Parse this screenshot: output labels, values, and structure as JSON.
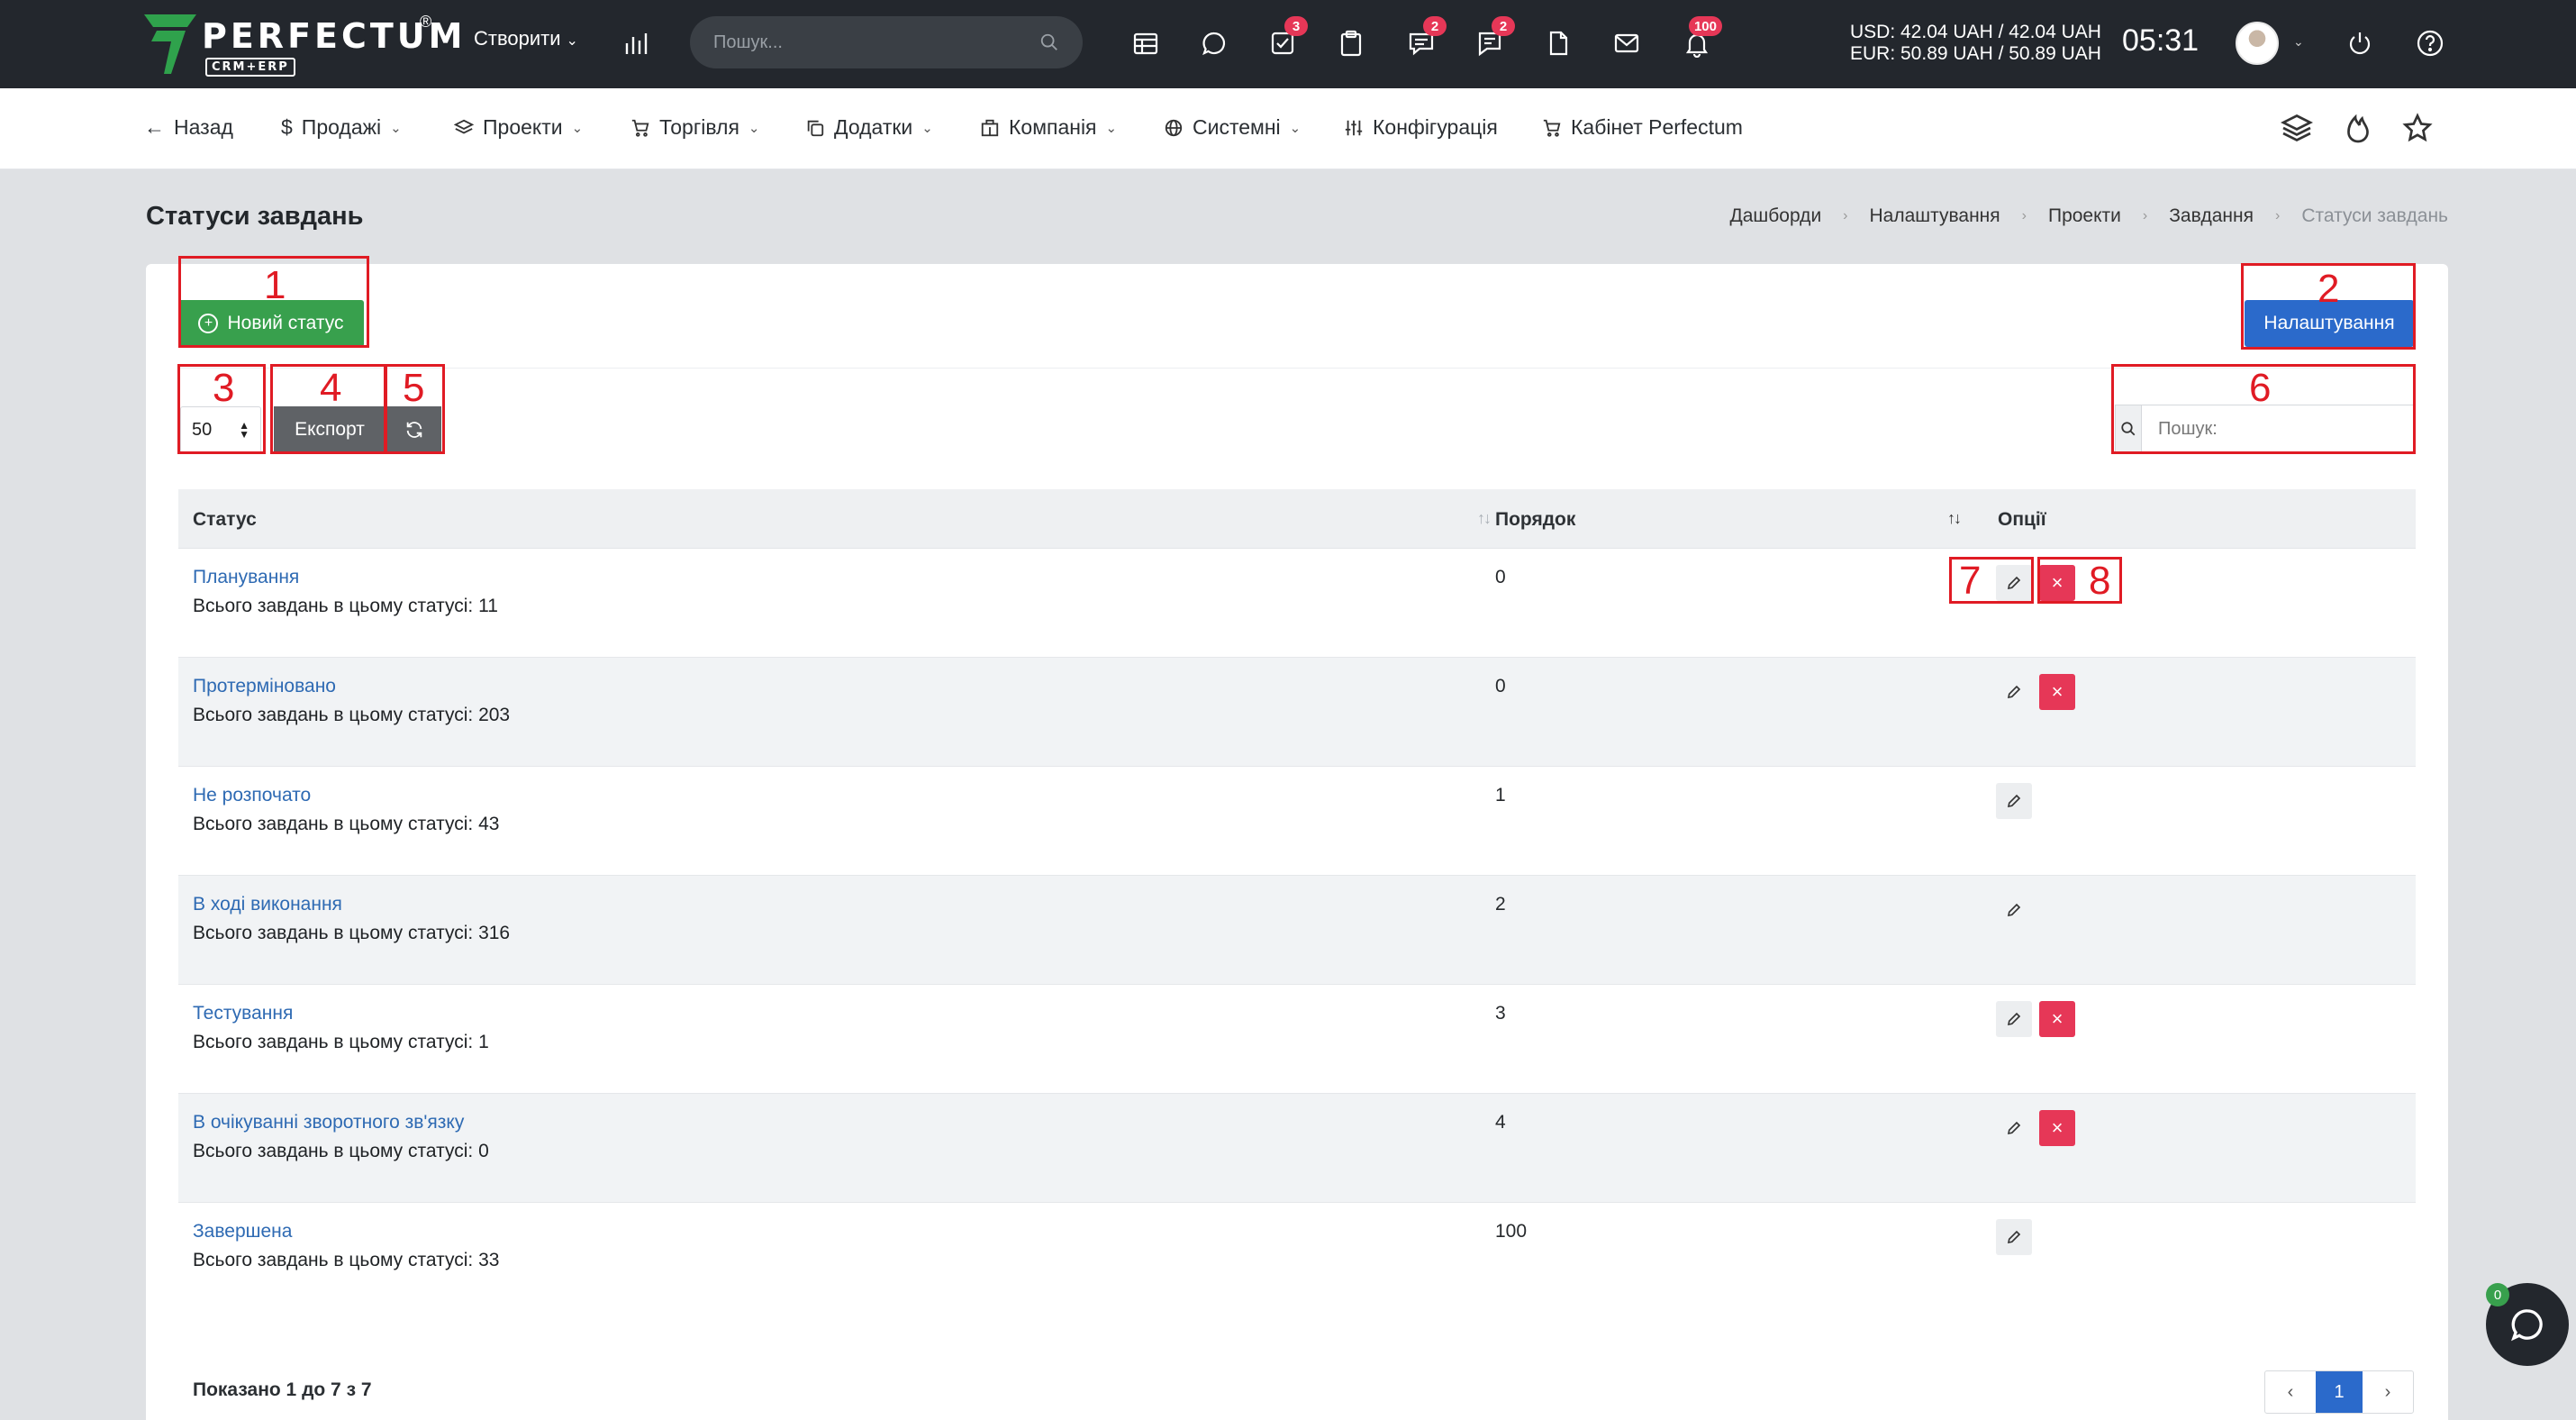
{
  "topbar": {
    "brand": "PERFECTUM",
    "brand_sub": "CRM+ERP",
    "reg_mark": "®",
    "create_label": "Створити",
    "search_placeholder": "Пошук...",
    "badges": {
      "tasks": "3",
      "chat": "2",
      "messages": "2",
      "notifications": "100"
    },
    "usd_rate": "USD: 42.04 UAH / 42.04 UAH",
    "eur_rate": "EUR: 50.89 UAH / 50.89 UAH",
    "time": "05:31"
  },
  "nav": {
    "back": "Назад",
    "sales": "Продажі",
    "projects": "Проекти",
    "trade": "Торгівля",
    "addons": "Додатки",
    "company": "Компанія",
    "system": "Системні",
    "config": "Конфігурація",
    "cabinet": "Кабінет Perfectum"
  },
  "page": {
    "title": "Статуси завдань",
    "breadcrumb": [
      "Дашборди",
      "Налаштування",
      "Проекти",
      "Завдання",
      "Статуси завдань"
    ]
  },
  "toolbar": {
    "new_status": "Новий статус",
    "settings": "Налаштування",
    "page_length": "50",
    "export": "Експорт",
    "search_placeholder": "Пошук:"
  },
  "annotations": [
    "1",
    "2",
    "3",
    "4",
    "5",
    "6",
    "7",
    "8"
  ],
  "table": {
    "columns": [
      "Статус",
      "Порядок",
      "Опції"
    ],
    "count_prefix": "Всього завдань в цьому статусі:",
    "rows": [
      {
        "name": "Планування",
        "count_text": "Всього завдань в цьому статусі: 11",
        "order": "0",
        "can_delete": true
      },
      {
        "name": "Протерміновано",
        "count_text": "Всього завдань в цьому статусі: 203",
        "order": "0",
        "can_delete": true
      },
      {
        "name": "Не розпочато",
        "count_text": "Всього завдань в цьому статусі: 43",
        "order": "1",
        "can_delete": false
      },
      {
        "name": "В ході виконання",
        "count_text": "Всього завдань в цьому статусі: 316",
        "order": "2",
        "can_delete": false
      },
      {
        "name": "Тестування",
        "count_text": "Всього завдань в цьому статусі: 1",
        "order": "3",
        "can_delete": true
      },
      {
        "name": "В очікуванні зворотного зв'язку",
        "count_text": "Всього завдань в цьому статусі: 0",
        "order": "4",
        "can_delete": true
      },
      {
        "name": "Завершена",
        "count_text": "Всього завдань в цьому статусі: 33",
        "order": "100",
        "can_delete": false
      }
    ]
  },
  "footer": {
    "info": "Показано 1 до 7 з 7",
    "current_page": "1"
  },
  "chat_widget": {
    "badge": "0"
  },
  "colors": {
    "topbar": "#23272d",
    "success": "#38a04d",
    "primary": "#2b6acb",
    "danger": "#e63757",
    "link": "#2e6ab3",
    "annotation": "#e01b24"
  }
}
